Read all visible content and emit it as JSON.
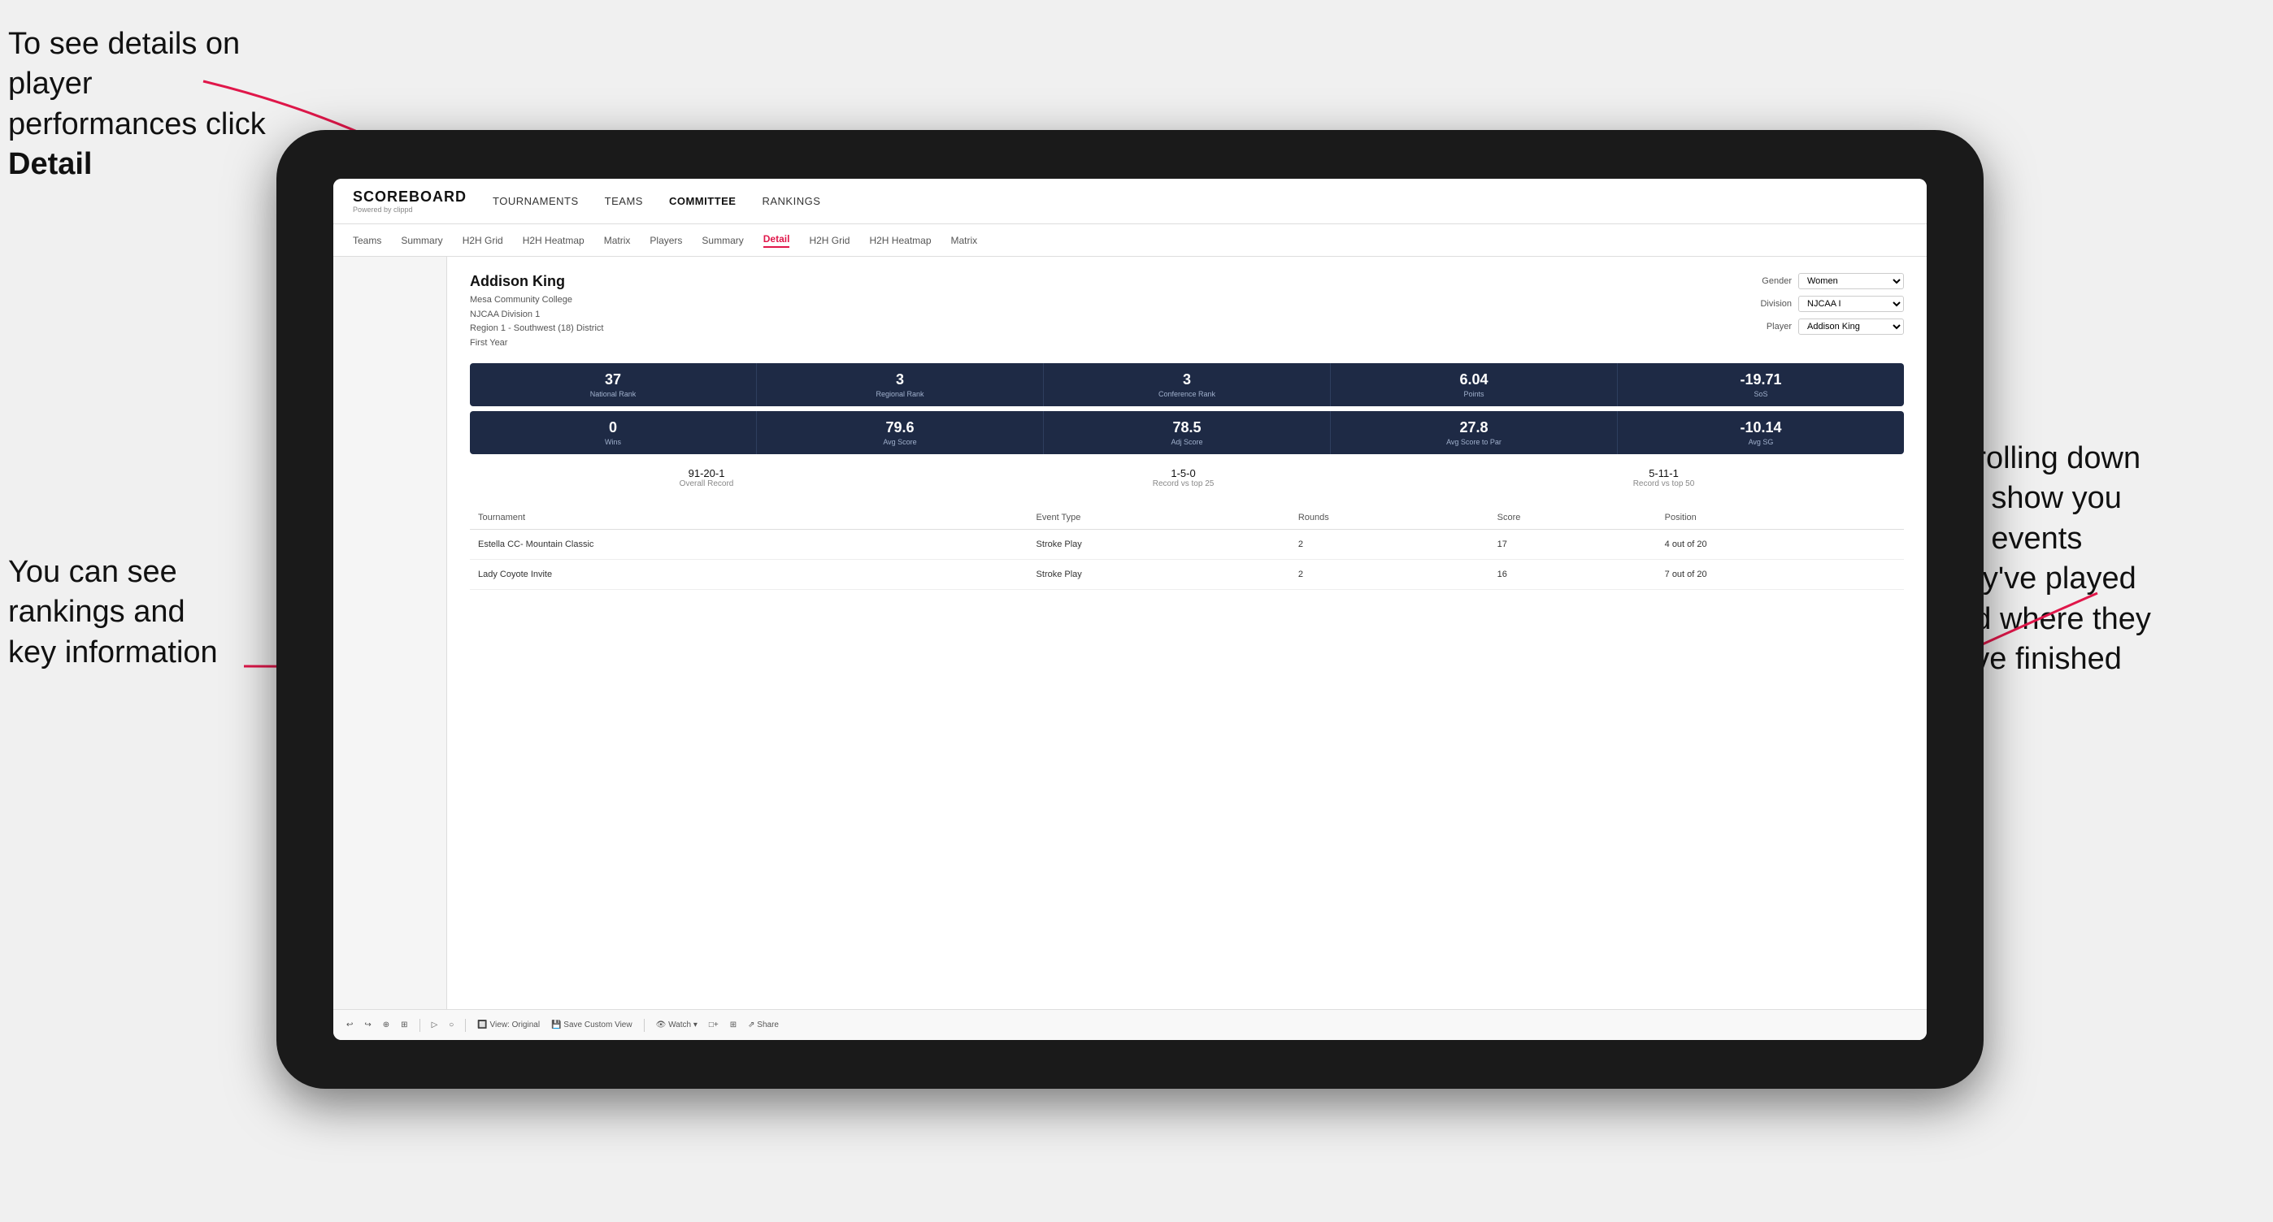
{
  "annotations": {
    "topleft": "To see details on player performances click ",
    "topleft_bold": "Detail",
    "bottomleft_line1": "You can see",
    "bottomleft_line2": "rankings and",
    "bottomleft_line3": "key information",
    "right_line1": "Scrolling down",
    "right_line2": "will show you",
    "right_line3": "the events",
    "right_line4": "they've played",
    "right_line5": "and where they",
    "right_line6": "have finished"
  },
  "nav": {
    "logo": "SCOREBOARD",
    "logo_sub": "Powered by clippd",
    "links": [
      "TOURNAMENTS",
      "TEAMS",
      "COMMITTEE",
      "RANKINGS"
    ],
    "active_link": "COMMITTEE"
  },
  "subnav": {
    "links": [
      "Teams",
      "Summary",
      "H2H Grid",
      "H2H Heatmap",
      "Matrix",
      "Players",
      "Summary",
      "Detail",
      "H2H Grid",
      "H2H Heatmap",
      "Matrix"
    ],
    "active": "Detail"
  },
  "player": {
    "name": "Addison King",
    "school": "Mesa Community College",
    "division": "NJCAA Division 1",
    "region": "Region 1 - Southwest (18) District",
    "year": "First Year",
    "gender_label": "Gender",
    "gender_value": "Women",
    "division_label": "Division",
    "division_value": "NJCAA I",
    "player_label": "Player",
    "player_value": "Addison King"
  },
  "stats_row1": [
    {
      "value": "37",
      "label": "National Rank"
    },
    {
      "value": "3",
      "label": "Regional Rank"
    },
    {
      "value": "3",
      "label": "Conference Rank"
    },
    {
      "value": "6.04",
      "label": "Points"
    },
    {
      "value": "-19.71",
      "label": "SoS"
    }
  ],
  "stats_row2": [
    {
      "value": "0",
      "label": "Wins"
    },
    {
      "value": "79.6",
      "label": "Avg Score"
    },
    {
      "value": "78.5",
      "label": "Adj Score"
    },
    {
      "value": "27.8",
      "label": "Avg Score to Par"
    },
    {
      "value": "-10.14",
      "label": "Avg SG"
    }
  ],
  "records": [
    {
      "value": "91-20-1",
      "label": "Overall Record"
    },
    {
      "value": "1-5-0",
      "label": "Record vs top 25"
    },
    {
      "value": "5-11-1",
      "label": "Record vs top 50"
    }
  ],
  "table": {
    "headers": [
      "Tournament",
      "Event Type",
      "Rounds",
      "Score",
      "Position"
    ],
    "rows": [
      {
        "tournament": "Estella CC- Mountain Classic",
        "event_type": "Stroke Play",
        "rounds": "2",
        "score": "17",
        "position": "4 out of 20"
      },
      {
        "tournament": "Lady Coyote Invite",
        "event_type": "Stroke Play",
        "rounds": "2",
        "score": "16",
        "position": "7 out of 20"
      }
    ]
  },
  "toolbar": {
    "buttons": [
      "↩",
      "↪",
      "⊕",
      "⊞",
      "▷",
      "○",
      "View: Original",
      "Save Custom View",
      "Watch ▾",
      "□+",
      "⊞",
      "Share"
    ]
  }
}
